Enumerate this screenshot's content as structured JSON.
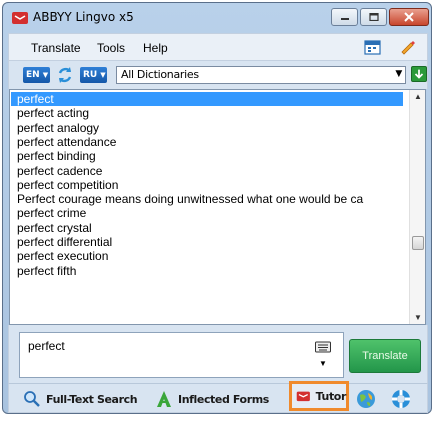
{
  "window": {
    "title": "ABBYY Lingvo x5",
    "icon": "lingvo-logo-icon"
  },
  "menu": {
    "items": [
      "Translate",
      "Tools",
      "Help"
    ],
    "tools": [
      "calendar-icon",
      "pen-icon"
    ]
  },
  "dictionary": {
    "from_lang": "EN",
    "to_lang": "RU",
    "selected": "All Dictionaries"
  },
  "wordlist": {
    "selected_index": 0,
    "items": [
      "perfect",
      "perfect acting",
      "perfect analogy",
      "perfect attendance",
      "perfect binding",
      "perfect cadence",
      "perfect competition",
      "Perfect courage means doing unwitnessed what one would be ca",
      "perfect crime",
      "perfect crystal",
      "perfect differential",
      "perfect execution",
      "perfect fifth"
    ]
  },
  "input": {
    "value": "perfect",
    "translate_label": "Translate"
  },
  "bottombar": {
    "full_text_search": "Full-Text Search",
    "inflected_forms": "Inflected Forms",
    "tutor": "Tutor",
    "highlight_color": "#f08a2c"
  },
  "colors": {
    "selection": "#3399ff",
    "translate_button": "#2fa855",
    "frame": "#b9d1ea"
  }
}
